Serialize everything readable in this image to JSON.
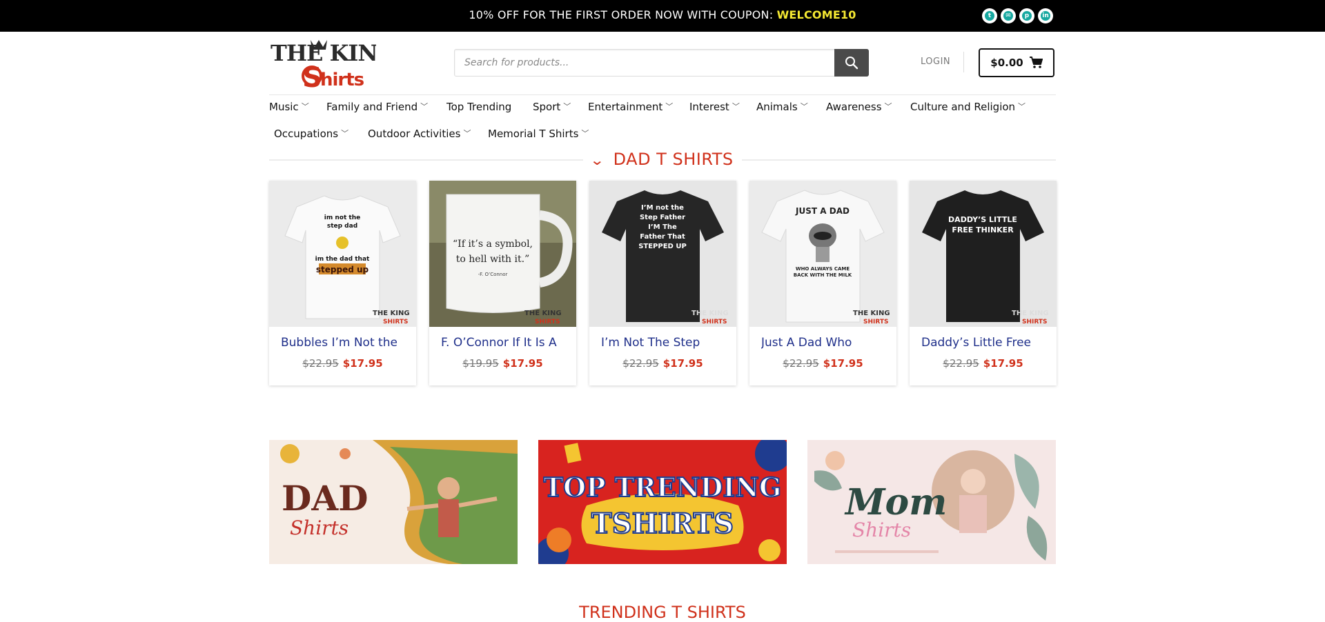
{
  "topbar": {
    "message": "10% OFF FOR THE FIRST ORDER NOW WITH COUPON: ",
    "coupon": "WELCOME10"
  },
  "header": {
    "logo_text": "THE KING SHIRTS",
    "search_placeholder": "Search for products...",
    "login": "LOGIN",
    "cart_total": "$0.00"
  },
  "nav": {
    "row1": [
      "Music",
      "Family and Friend",
      "Top Trending",
      "Sport",
      "Entertainment",
      "Interest",
      "Animals",
      "Awareness",
      "Culture and Religion"
    ],
    "row2": [
      "Occupations",
      "Outdoor Activities",
      "Memorial T Shirts"
    ]
  },
  "section": {
    "title": "DAD T SHIRTS"
  },
  "products": [
    {
      "name": "Bubbles I’m Not the",
      "old_price": "$22.95",
      "price": "$17.95"
    },
    {
      "name": "F. O’Connor If It Is A",
      "old_price": "$19.95",
      "price": "$17.95"
    },
    {
      "name": "I’m Not The Step",
      "old_price": "$22.95",
      "price": "$17.95"
    },
    {
      "name": "Just A Dad Who",
      "old_price": "$22.95",
      "price": "$17.95"
    },
    {
      "name": "Daddy’s Little Free",
      "old_price": "$22.95",
      "price": "$17.95"
    }
  ],
  "product_art": [
    {
      "line1": "im not the",
      "line2": "step dad",
      "line3": "im the dad that",
      "line4": "stepped up"
    },
    {
      "line1": "“If it’s a symbol,",
      "line2": "to hell with it.”",
      "line3": "-F. O’Connor"
    },
    {
      "line1": "I’M not the",
      "line2": "Step Father",
      "line3": "I’M The",
      "line4": "Father That",
      "line5": "STEPPED UP"
    },
    {
      "line1": "JUST A DAD",
      "line2": "WHO ALWAYS CAME",
      "line3": "BACK WITH THE MILK"
    },
    {
      "line1": "DADDY’S LITTLE",
      "line2": "FREE THINKER"
    }
  ],
  "watermark": {
    "line1": "THE KING",
    "line2": "SHIRTS"
  },
  "banners": [
    {
      "line1": "DAD",
      "line2": "Shirts"
    },
    {
      "line1": "TOP TRENDING",
      "line2": "TSHIRTS"
    },
    {
      "line1": "Mom",
      "line2": "Shirts"
    }
  ],
  "bottom_section": {
    "title": "TRENDING T SHIRTS"
  },
  "colors": {
    "accent": "#d0311b",
    "product_name": "#1f2f8a",
    "coupon": "#f5e932",
    "social": "#16a8a0"
  },
  "icons": [
    "twitter-icon",
    "email-icon",
    "pinterest-icon",
    "linkedin-icon",
    "search-icon",
    "cart-icon",
    "chevron-down-icon"
  ]
}
